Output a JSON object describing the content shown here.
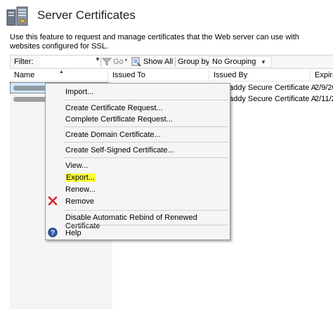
{
  "header": {
    "title": "Server Certificates",
    "description": "Use this feature to request and manage certificates that the Web server can use with websites configured for SSL."
  },
  "toolbar": {
    "filter_label": "Filter:",
    "filter_value": "",
    "go_label": "Go",
    "show_all_label": "Show All",
    "group_by_label": "Group by:",
    "group_by_value": "No Grouping"
  },
  "table": {
    "columns": [
      "Name",
      "Issued To",
      "Issued By",
      "Expira"
    ],
    "rows": [
      {
        "issued_by": "addy Secure Certificate A...",
        "expiration": "2/9/20"
      },
      {
        "issued_by": "addy Secure Certificate A...",
        "expiration": "2/11/2"
      }
    ]
  },
  "context_menu": {
    "items": [
      {
        "label": "Import...",
        "icon": ""
      },
      {
        "label": "Create Certificate Request...",
        "icon": ""
      },
      {
        "label": "Complete Certificate Request...",
        "icon": ""
      },
      {
        "label": "Create Domain Certificate...",
        "icon": ""
      },
      {
        "label": "Create Self-Signed Certificate...",
        "icon": ""
      },
      {
        "label": "View...",
        "icon": ""
      },
      {
        "label": "Export...",
        "icon": "",
        "highlighted": true,
        "highlight_color": "#fbff3a"
      },
      {
        "label": "Renew...",
        "icon": ""
      },
      {
        "label": "Remove",
        "icon": "red-x-icon"
      },
      {
        "label": "Disable Automatic Rebind of Renewed Certificate",
        "icon": ""
      },
      {
        "label": "Help",
        "icon": "help-icon"
      }
    ]
  },
  "colors": {
    "selection": "#cde8ff",
    "remove_icon": "#d9262c",
    "help_icon": "#2c5aa0"
  }
}
